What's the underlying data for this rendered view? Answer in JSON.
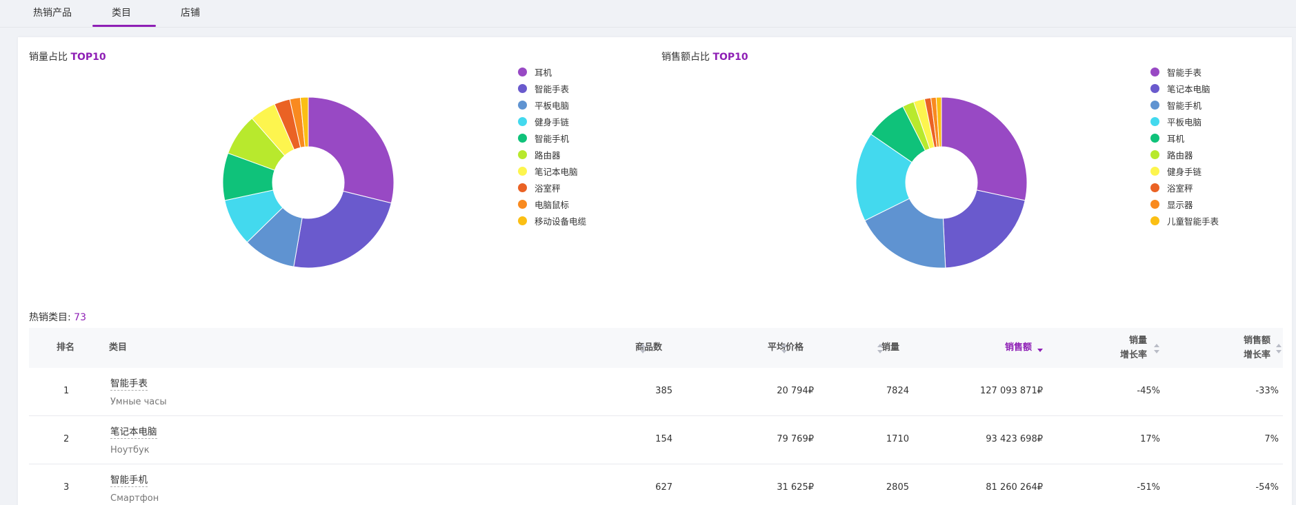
{
  "tabs": [
    {
      "label": "热销产品"
    },
    {
      "label": "类目"
    },
    {
      "label": "店铺"
    }
  ],
  "charts": {
    "volume": {
      "title_prefix": "销量占比 ",
      "title_highlight": "TOP10"
    },
    "revenue": {
      "title_prefix": "销售额占比 ",
      "title_highlight": "TOP10"
    }
  },
  "chart_data": [
    {
      "type": "pie",
      "title": "销量占比 TOP10",
      "legend": "right",
      "categories": [
        "耳机",
        "智能手表",
        "平板电脑",
        "健身手链",
        "智能手机",
        "路由器",
        "笔记本电脑",
        "浴室秤",
        "电脑鼠标",
        "移动设备电缆"
      ],
      "values": [
        29,
        24,
        10,
        9,
        9,
        8,
        5,
        3,
        2,
        1.5
      ],
      "colors": [
        "#9849c4",
        "#6a5acd",
        "#5f93d1",
        "#43d9ee",
        "#0fc27a",
        "#b8e92d",
        "#fdf54e",
        "#ea6224",
        "#f98a1f",
        "#fbbf14"
      ]
    },
    {
      "type": "pie",
      "title": "销售额占比 TOP10",
      "legend": "right",
      "categories": [
        "智能手表",
        "笔记本电脑",
        "智能手机",
        "平板电脑",
        "耳机",
        "路由器",
        "健身手链",
        "浴室秤",
        "显示器",
        "儿童智能手表"
      ],
      "values": [
        28.5,
        21,
        18.5,
        17,
        8,
        2.2,
        2.1,
        1.2,
        1,
        1
      ],
      "colors": [
        "#9849c4",
        "#6a5acd",
        "#5f93d1",
        "#43d9ee",
        "#0fc27a",
        "#b8e92d",
        "#fdf54e",
        "#ea6224",
        "#f98a1f",
        "#fbbf14"
      ]
    }
  ],
  "hot": {
    "label": "热销类目: ",
    "count": "73"
  },
  "table": {
    "headers": {
      "rank": "排名",
      "category": "类目",
      "products": "商品数",
      "avg_price": "平均价格",
      "volume": "销量",
      "revenue": "销售额",
      "vol_growth_1": "销量",
      "vol_growth_2": "增长率",
      "rev_growth_1": "销售额",
      "rev_growth_2": "增长率"
    },
    "rows": [
      {
        "rank": "1",
        "name": "智能手表",
        "sub": "Умные часы",
        "products": "385",
        "avg_price": "20 794₽",
        "volume": "7824",
        "revenue": "127 093 871₽",
        "vol_growth": "-45%",
        "rev_growth": "-33%"
      },
      {
        "rank": "2",
        "name": "笔记本电脑",
        "sub": "Ноутбук",
        "products": "154",
        "avg_price": "79 769₽",
        "volume": "1710",
        "revenue": "93 423 698₽",
        "vol_growth": "17%",
        "rev_growth": "7%"
      },
      {
        "rank": "3",
        "name": "智能手机",
        "sub": "Смартфон",
        "products": "627",
        "avg_price": "31 625₽",
        "volume": "2805",
        "revenue": "81 260 264₽",
        "vol_growth": "-51%",
        "rev_growth": "-54%"
      }
    ]
  },
  "colors": {
    "accent": "#8e1fb5"
  }
}
